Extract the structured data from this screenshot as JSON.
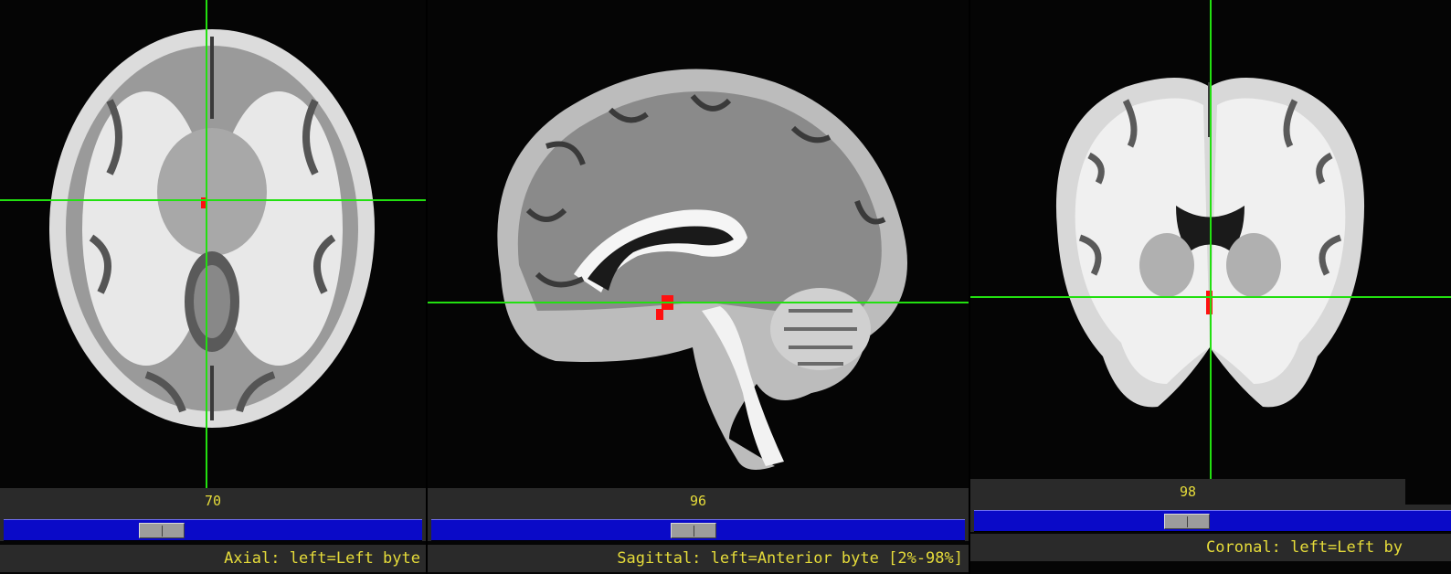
{
  "colors": {
    "crosshair": "#22e010",
    "roi": "#ff1010",
    "panel_bg": "#050505",
    "bar_bg": "#2a2a2a",
    "slider_track": "#0a0ac8",
    "label_text": "#e6dc3a"
  },
  "views": [
    {
      "id": "axial",
      "slice_label": "70",
      "caption": "Axial: left=Left byte",
      "slider_position": 0.34
    },
    {
      "id": "sagittal",
      "slice_label": "96",
      "caption": "Sagittal: left=Anterior byte [2%-98%]",
      "slider_position": 0.5
    },
    {
      "id": "coronal",
      "slice_label": "98",
      "caption": "Coronal: left=Left by",
      "slider_position": 0.5
    }
  ]
}
